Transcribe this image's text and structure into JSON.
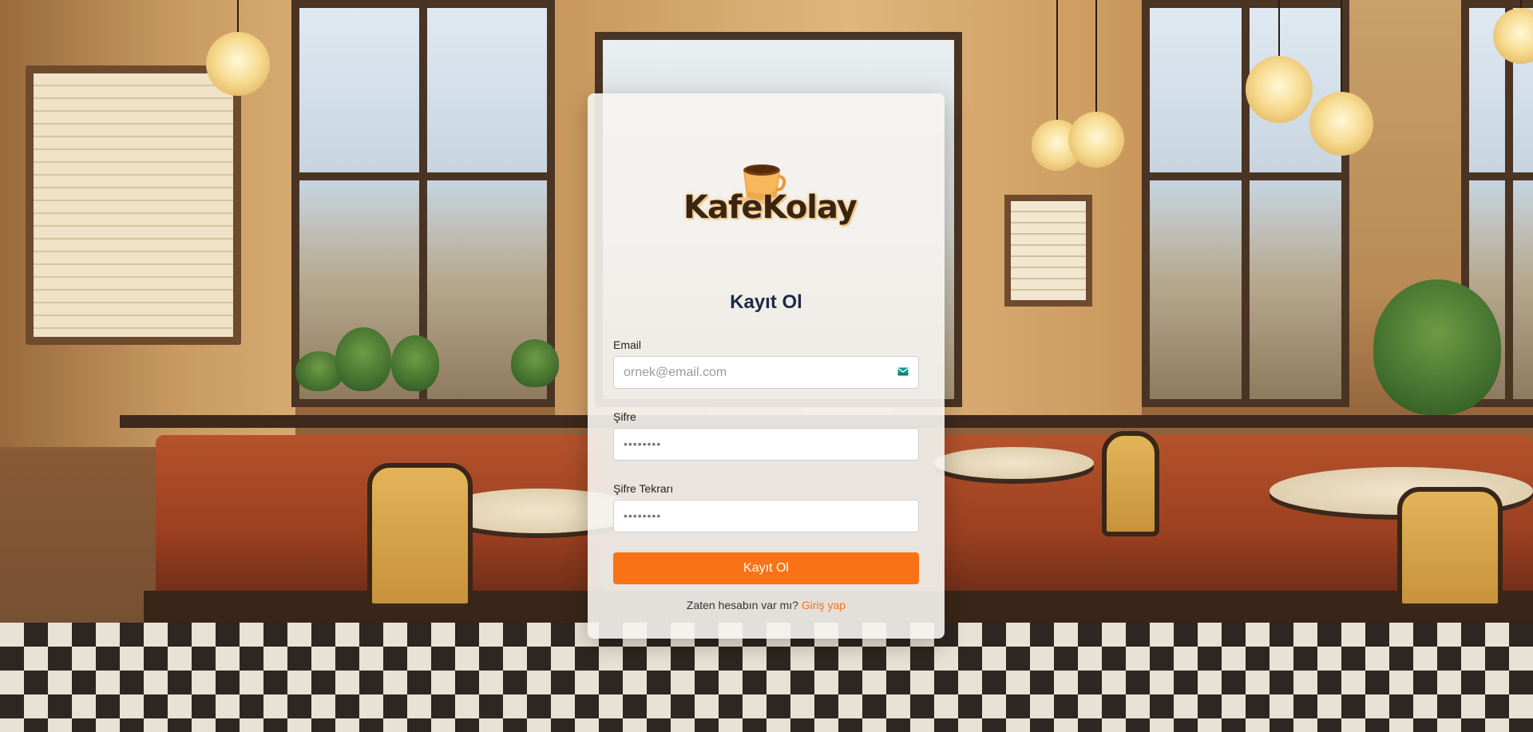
{
  "brand": {
    "name": "KafeKolay"
  },
  "form": {
    "title": "Kayıt Ol",
    "email_label": "Email",
    "email_placeholder": "ornek@email.com",
    "password_label": "Şifre",
    "password_value": "••••••••",
    "password_repeat_label": "Şifre Tekrarı",
    "password_repeat_value": "••••••••",
    "submit_label": "Kayıt Ol"
  },
  "footer": {
    "prompt": "Zaten hesabın var mı?",
    "login_link": "Giriş yap"
  },
  "icons": {
    "email_field": "mail-icon",
    "logo": "coffee-cup-icon"
  },
  "colors": {
    "accent": "#f97316",
    "title": "#1d2b44",
    "mail_icon": "#0f9d8a"
  }
}
